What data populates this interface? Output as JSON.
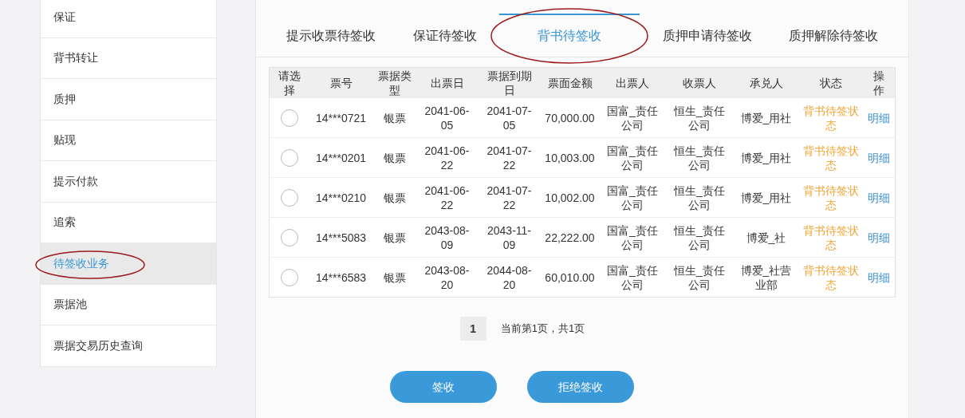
{
  "sidebar": {
    "items": [
      {
        "label": "保证",
        "selected": false
      },
      {
        "label": "背书转让",
        "selected": false
      },
      {
        "label": "质押",
        "selected": false
      },
      {
        "label": "贴现",
        "selected": false
      },
      {
        "label": "提示付款",
        "selected": false
      },
      {
        "label": "追索",
        "selected": false
      },
      {
        "label": "待签收业务",
        "selected": true,
        "annotated": true
      },
      {
        "label": "票据池",
        "selected": false
      },
      {
        "label": "票据交易历史查询",
        "selected": false
      }
    ]
  },
  "tabs": [
    {
      "label": "提示收票待签收",
      "selected": false
    },
    {
      "label": "保证待签收",
      "selected": false
    },
    {
      "label": "背书待签收",
      "selected": true,
      "annotated": true
    },
    {
      "label": "质押申请待签收",
      "selected": false
    },
    {
      "label": "质押解除待签收",
      "selected": false
    }
  ],
  "table": {
    "columns": [
      "请选择",
      "票号",
      "票据类型",
      "出票日",
      "票据到期日",
      "票面金额",
      "出票人",
      "收票人",
      "承兑人",
      "状态",
      "操作"
    ],
    "rows": [
      {
        "checked": false,
        "cells": [
          "",
          "14***0721",
          "银票",
          "2041-06-05",
          "2041-07-05",
          "70,000.00",
          "国富_责任公司",
          "恒生_责任公司",
          "博爱_用社",
          "背书待签状态",
          "明细"
        ]
      },
      {
        "checked": false,
        "cells": [
          "",
          "14***0201",
          "银票",
          "2041-06-22",
          "2041-07-22",
          "10,003.00",
          "国富_责任公司",
          "恒生_责任公司",
          "博爱_用社",
          "背书待签状态",
          "明细"
        ]
      },
      {
        "checked": false,
        "cells": [
          "",
          "14***0210",
          "银票",
          "2041-06-22",
          "2041-07-22",
          "10,002.00",
          "国富_责任公司",
          "恒生_责任公司",
          "博爱_用社",
          "背书待签状态",
          "明细"
        ]
      },
      {
        "checked": false,
        "cells": [
          "",
          "14***5083",
          "银票",
          "2043-08-09",
          "2043-11-09",
          "22,222.00",
          "国富_责任公司",
          "恒生_责任公司",
          "博爱_社",
          "背书待签状态",
          "明细"
        ]
      },
      {
        "checked": false,
        "cells": [
          "",
          "14***6583",
          "银票",
          "2043-08-20",
          "2044-08-20",
          "60,010.00",
          "国富_责任公司",
          "恒生_责任公司",
          "博爱_社营业部",
          "背书待签状态",
          "明细"
        ]
      }
    ]
  },
  "pagination": {
    "page": "1",
    "summary": "当前第1页，共1页"
  },
  "buttons": [
    "签收",
    "拒绝签收"
  ]
}
